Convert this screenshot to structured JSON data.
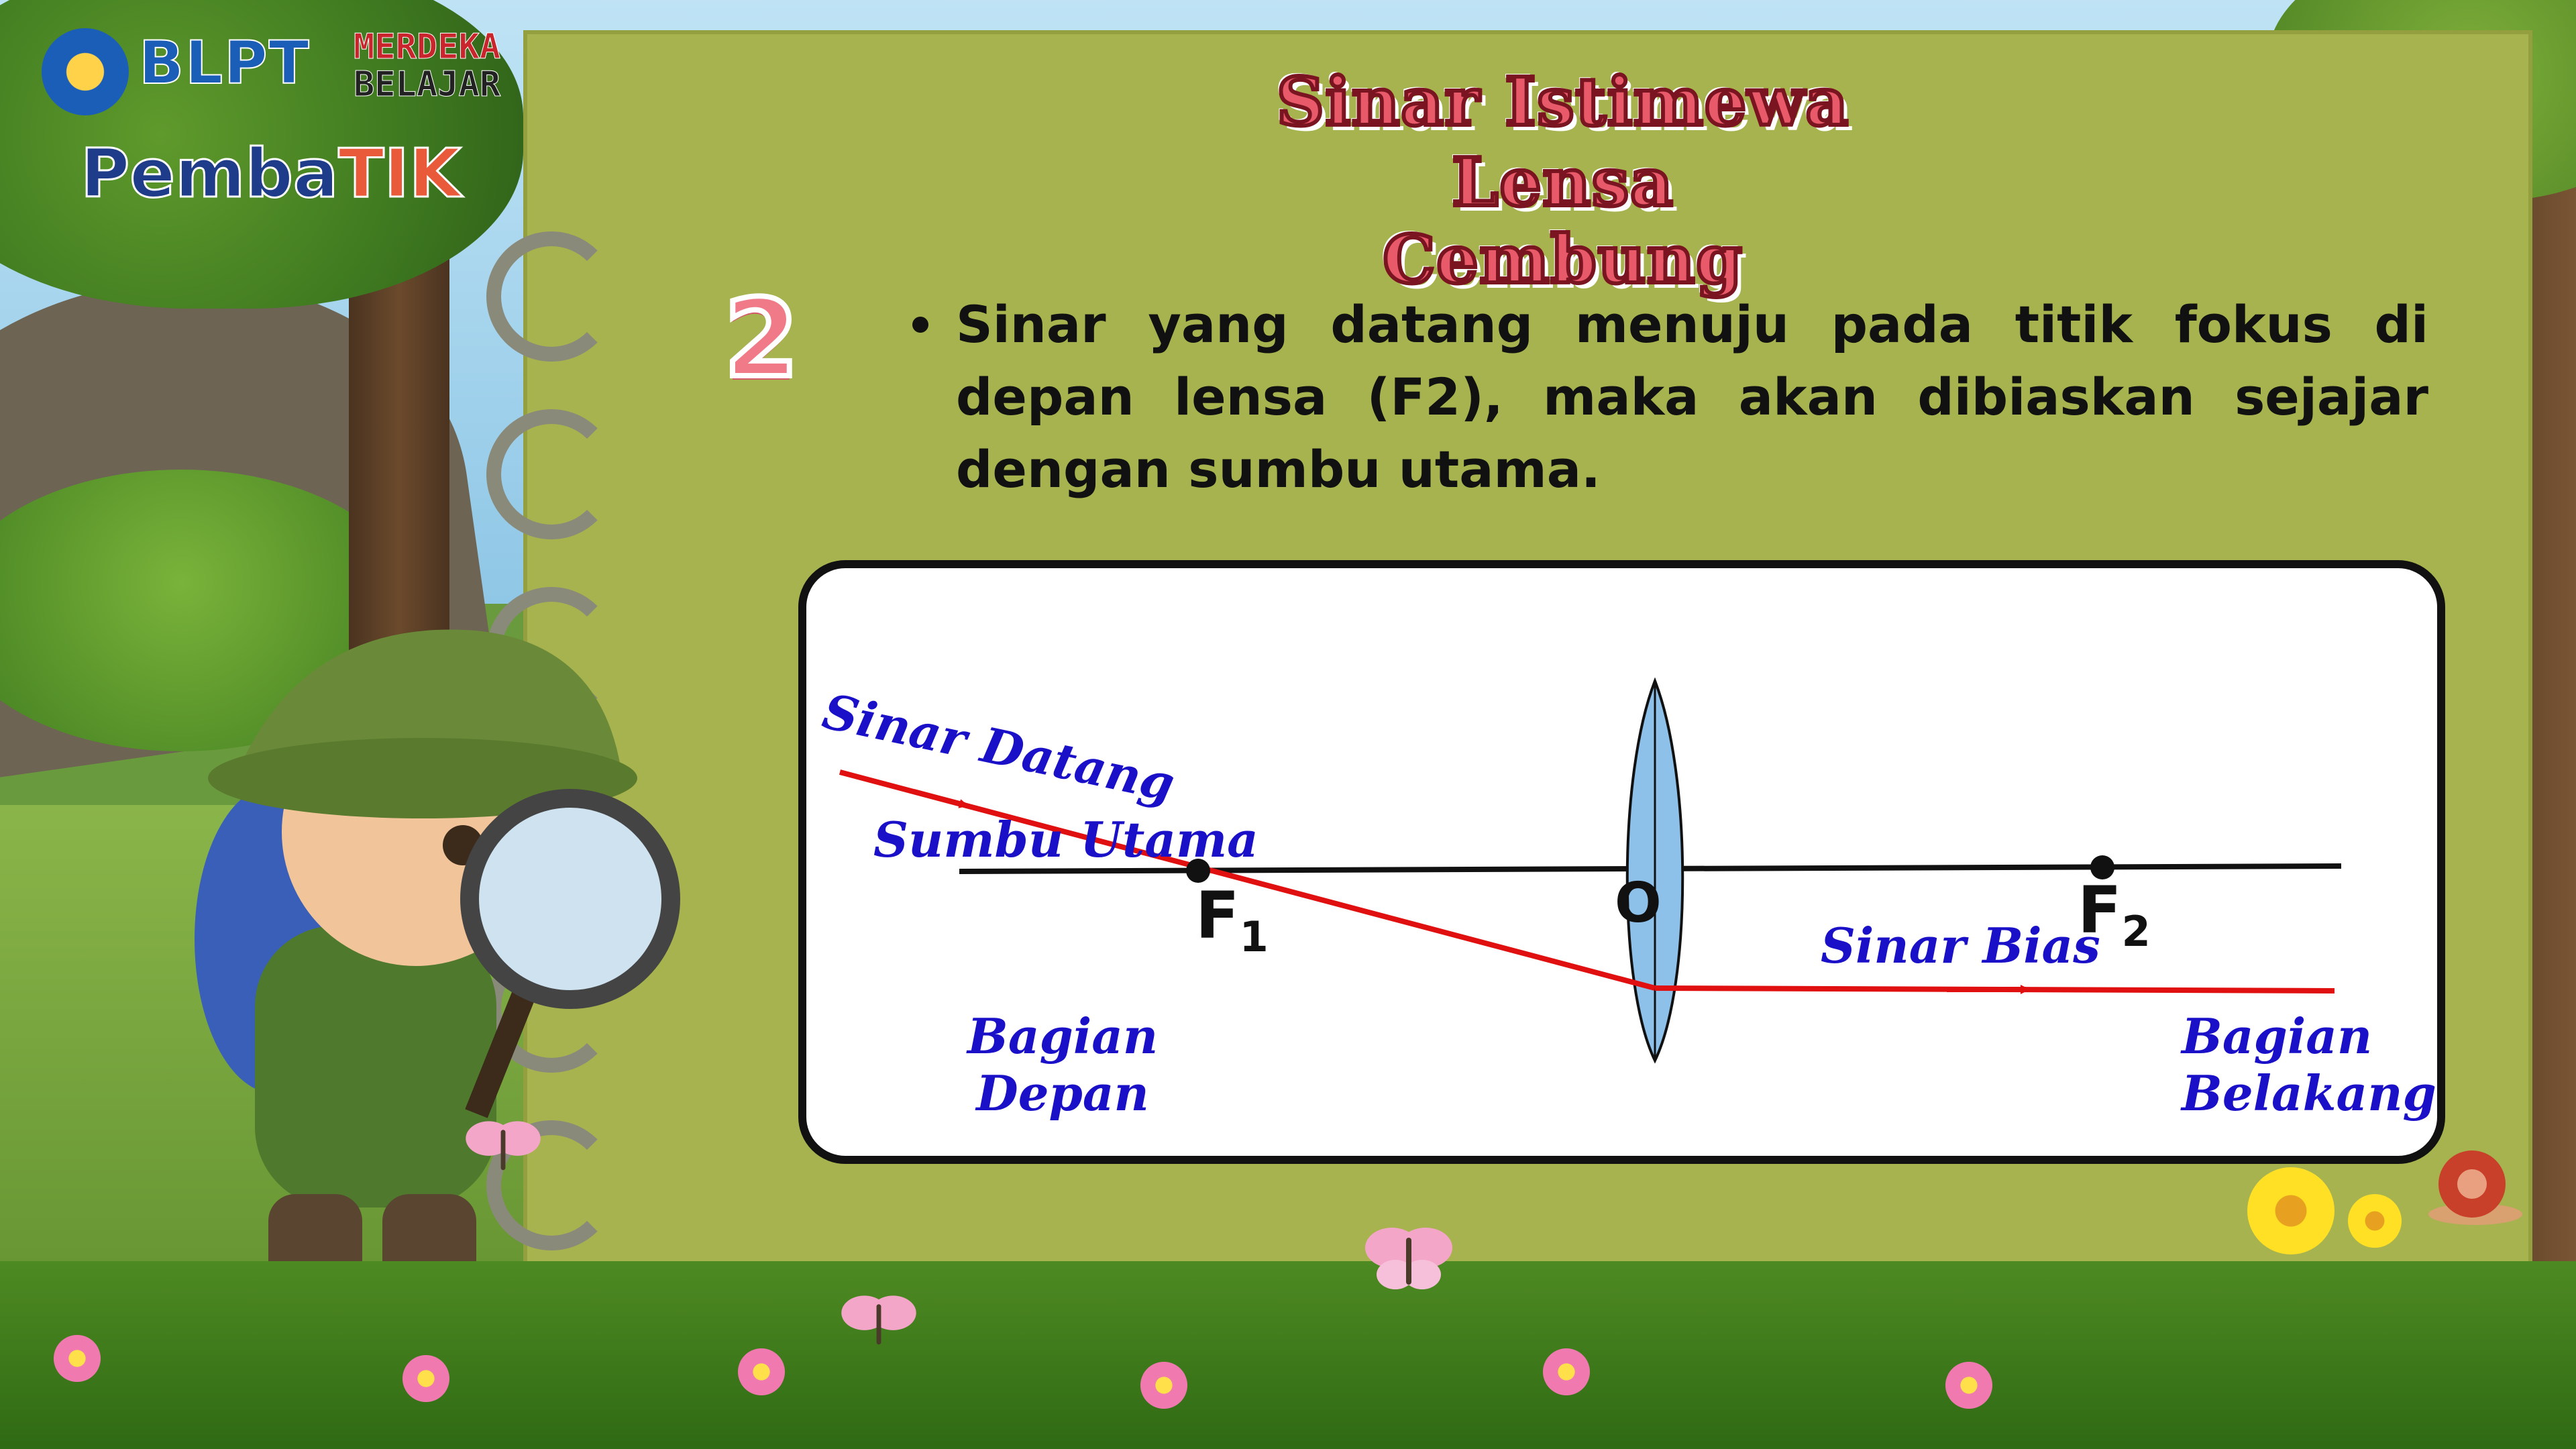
{
  "header": {
    "logo_blpt": "BLPT",
    "logo_merdeka": "MERDEKA",
    "logo_belajar": "BELAJAR",
    "logo_pembatik_a": "Pemba",
    "logo_pembatik_b": "TIK"
  },
  "slide": {
    "title_line1": "Sinar Istimewa",
    "title_line2": "Lensa Cembung",
    "step_number": "2",
    "statement": "Sinar yang datang menuju pada titik fokus di depan lensa (F2), maka akan dibiaskan sejajar dengan sumbu utama."
  },
  "diagram": {
    "labels": {
      "incoming_ray": "Sinar Datang",
      "principal_axis": "Sumbu Utama",
      "refracted_ray": "Sinar Bias",
      "front_line1": "Bagian",
      "front_line2": "Depan",
      "back_line1": "Bagian",
      "back_line2": "Belakang",
      "optical_center": "O",
      "focus1": "F",
      "focus1_sub": "1",
      "focus2": "F",
      "focus2_sub": "2"
    },
    "colors": {
      "ray": "#e01010",
      "lens_fill": "#8ec1ea",
      "label_text": "#1a10c8",
      "axis": "#111111"
    }
  },
  "colors": {
    "board": "#a7b34e",
    "title_fill": "#e85a6a",
    "title_stroke": "#7a1420"
  },
  "icons": [
    "seal-icon",
    "explorer-illustration",
    "magnifier-icon",
    "butterfly-icon",
    "flower-icon",
    "snail-icon"
  ]
}
